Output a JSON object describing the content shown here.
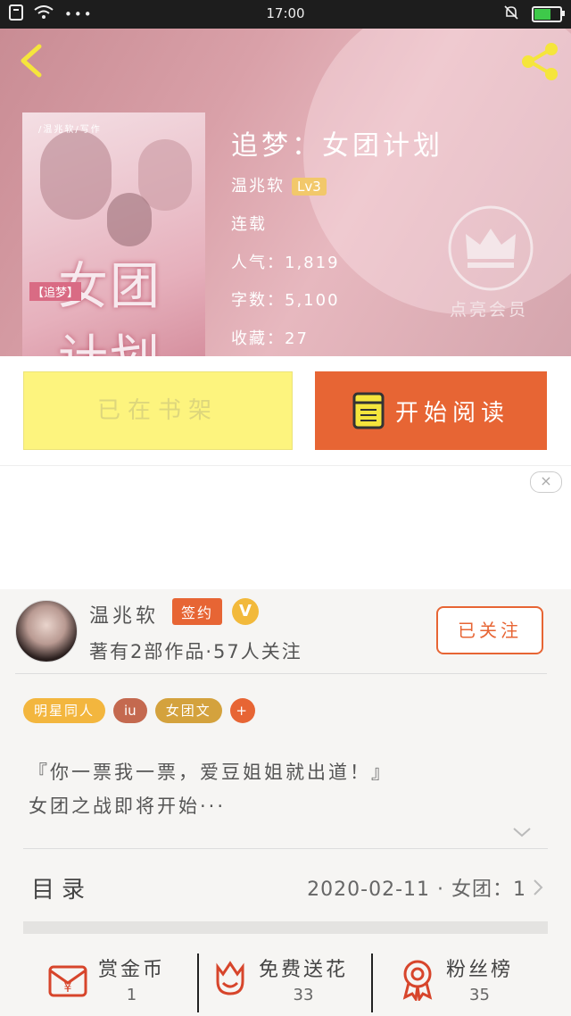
{
  "status_bar": {
    "time": "17:00"
  },
  "hero": {
    "book_title": "追梦：女团计划",
    "author": "温兆软",
    "level": "Lv3",
    "status": "连载",
    "popularity": "人气：1,819",
    "word_count": "字数：5,100",
    "favorites": "收藏：27",
    "vip_label": "点亮会员",
    "cover": {
      "top_tag": "/温兆软/写作",
      "title": "女团计划",
      "subtitle": "【追梦】"
    }
  },
  "actions": {
    "shelf_label": "已在书架",
    "read_label": "开始阅读"
  },
  "ad": {
    "close_symbol": "×"
  },
  "author_card": {
    "name": "温兆软",
    "sign_badge": "签约",
    "v_badge": "V",
    "stats": "著有2部作品·57人关注",
    "follow_label": "已关注"
  },
  "tags": [
    "明星同人",
    "iu",
    "女团文",
    "+"
  ],
  "intro": {
    "line1": "『你一票我一票，爱豆姐姐就出道！』",
    "line2": "女团之战即将开始···"
  },
  "catalog": {
    "label": "目录",
    "latest": "2020-02-11 · 女团：1"
  },
  "bottom_bar": {
    "reward": {
      "label": "赏金币",
      "count": "1"
    },
    "flower": {
      "label": "免费送花",
      "count": "33"
    },
    "fans": {
      "label": "粉丝榜",
      "count": "35"
    }
  },
  "colors": {
    "accent": "#e76534",
    "shelf_yellow": "#fdf47e",
    "tag_yellow": "#f3b63e"
  }
}
